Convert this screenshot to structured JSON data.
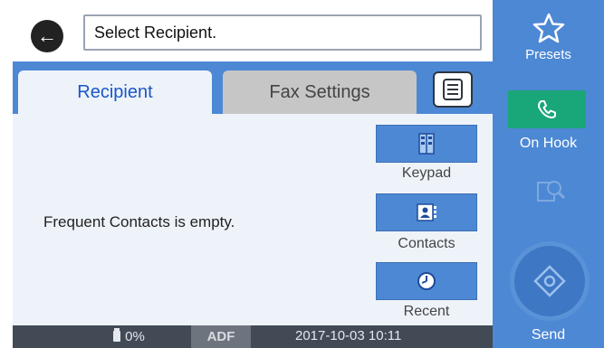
{
  "header": {
    "title": "Select Recipient."
  },
  "tabs": [
    {
      "label": "Recipient",
      "active": true
    },
    {
      "label": "Fax Settings",
      "active": false
    }
  ],
  "main": {
    "empty_message": "Frequent Contacts is empty."
  },
  "actions": {
    "keypad_label": "Keypad",
    "contacts_label": "Contacts",
    "recent_label": "Recent"
  },
  "sidebar": {
    "presets_label": "Presets",
    "onhook_label": "On Hook",
    "send_label": "Send"
  },
  "status": {
    "toner_percent": "0%",
    "source": "ADF",
    "datetime": "2017-10-03 10:11"
  },
  "icons": {
    "back": "back-arrow-icon",
    "menu": "menu-list-icon",
    "keypad": "keypad-icon",
    "contacts": "contacts-icon",
    "recent": "clock-icon",
    "presets": "star-icon",
    "onhook": "phone-icon",
    "preview": "preview-icon",
    "send": "send-diamond-icon",
    "toner": "ink-bottle-icon"
  },
  "colors": {
    "accent_blue": "#4d88d4",
    "tab_active_text": "#1a56c6",
    "onhook_green": "#19a679",
    "statusbar": "#424a55"
  }
}
